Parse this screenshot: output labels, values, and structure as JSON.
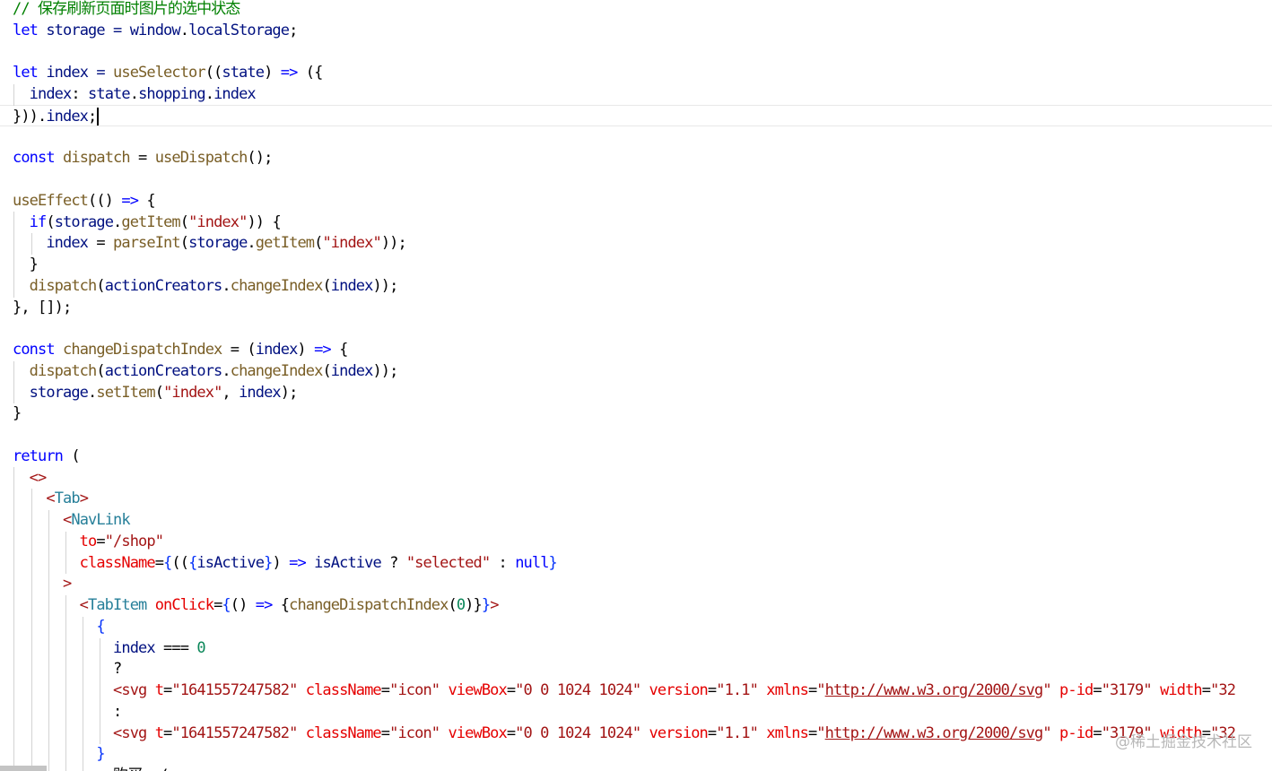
{
  "editor": {
    "lines": [
      {
        "tokens": [
          {
            "t": "// 保存刷新页面时图片的选中状态",
            "c": "comment"
          }
        ]
      },
      {
        "tokens": [
          {
            "t": "let",
            "c": "keyword"
          },
          {
            "t": " storage = ",
            "c": "var"
          },
          {
            "t": "window",
            "c": "var"
          },
          {
            "t": ".",
            "c": "punct"
          },
          {
            "t": "localStorage",
            "c": "var"
          },
          {
            "t": ";",
            "c": "punct"
          }
        ]
      },
      {
        "tokens": []
      },
      {
        "tokens": [
          {
            "t": "let",
            "c": "keyword"
          },
          {
            "t": " index = ",
            "c": "var"
          },
          {
            "t": "useSelector",
            "c": "func"
          },
          {
            "t": "((",
            "c": "punct"
          },
          {
            "t": "state",
            "c": "var"
          },
          {
            "t": ") ",
            "c": "punct"
          },
          {
            "t": "=>",
            "c": "keyword"
          },
          {
            "t": " ({",
            "c": "punct"
          }
        ]
      },
      {
        "tokens": [
          {
            "t": "  index",
            "c": "var"
          },
          {
            "t": ": ",
            "c": "punct"
          },
          {
            "t": "state",
            "c": "var"
          },
          {
            "t": ".",
            "c": "punct"
          },
          {
            "t": "shopping",
            "c": "var"
          },
          {
            "t": ".",
            "c": "punct"
          },
          {
            "t": "index",
            "c": "var"
          }
        ]
      },
      {
        "tokens": [
          {
            "t": "})).",
            "c": "punct"
          },
          {
            "t": "index",
            "c": "var"
          },
          {
            "t": ";",
            "c": "punct"
          }
        ],
        "current": true
      },
      {
        "tokens": []
      },
      {
        "tokens": [
          {
            "t": "const",
            "c": "keyword"
          },
          {
            "t": " dispatch",
            "c": "func"
          },
          {
            "t": " = ",
            "c": "punct"
          },
          {
            "t": "useDispatch",
            "c": "func"
          },
          {
            "t": "();",
            "c": "punct"
          }
        ]
      },
      {
        "tokens": []
      },
      {
        "tokens": [
          {
            "t": "useEffect",
            "c": "func"
          },
          {
            "t": "(() ",
            "c": "punct"
          },
          {
            "t": "=>",
            "c": "keyword"
          },
          {
            "t": " {",
            "c": "punct"
          }
        ]
      },
      {
        "tokens": [
          {
            "t": "  if",
            "c": "keyword"
          },
          {
            "t": "(",
            "c": "punct"
          },
          {
            "t": "storage",
            "c": "var"
          },
          {
            "t": ".",
            "c": "punct"
          },
          {
            "t": "getItem",
            "c": "func"
          },
          {
            "t": "(",
            "c": "punct"
          },
          {
            "t": "\"index\"",
            "c": "str"
          },
          {
            "t": ")) {",
            "c": "punct"
          }
        ]
      },
      {
        "tokens": [
          {
            "t": "    index",
            "c": "var"
          },
          {
            "t": " = ",
            "c": "punct"
          },
          {
            "t": "parseInt",
            "c": "func"
          },
          {
            "t": "(",
            "c": "punct"
          },
          {
            "t": "storage",
            "c": "var"
          },
          {
            "t": ".",
            "c": "punct"
          },
          {
            "t": "getItem",
            "c": "func"
          },
          {
            "t": "(",
            "c": "punct"
          },
          {
            "t": "\"index\"",
            "c": "str"
          },
          {
            "t": "));",
            "c": "punct"
          }
        ]
      },
      {
        "tokens": [
          {
            "t": "  }",
            "c": "punct"
          }
        ]
      },
      {
        "tokens": [
          {
            "t": "  dispatch",
            "c": "func"
          },
          {
            "t": "(",
            "c": "punct"
          },
          {
            "t": "actionCreators",
            "c": "var"
          },
          {
            "t": ".",
            "c": "punct"
          },
          {
            "t": "changeIndex",
            "c": "func"
          },
          {
            "t": "(",
            "c": "punct"
          },
          {
            "t": "index",
            "c": "var"
          },
          {
            "t": "));",
            "c": "punct"
          }
        ]
      },
      {
        "tokens": [
          {
            "t": "}, []);",
            "c": "punct"
          }
        ]
      },
      {
        "tokens": []
      },
      {
        "tokens": [
          {
            "t": "const",
            "c": "keyword"
          },
          {
            "t": " changeDispatchIndex",
            "c": "func"
          },
          {
            "t": " = (",
            "c": "punct"
          },
          {
            "t": "index",
            "c": "var"
          },
          {
            "t": ") ",
            "c": "punct"
          },
          {
            "t": "=>",
            "c": "keyword"
          },
          {
            "t": " {",
            "c": "punct"
          }
        ]
      },
      {
        "tokens": [
          {
            "t": "  dispatch",
            "c": "func"
          },
          {
            "t": "(",
            "c": "punct"
          },
          {
            "t": "actionCreators",
            "c": "var"
          },
          {
            "t": ".",
            "c": "punct"
          },
          {
            "t": "changeIndex",
            "c": "func"
          },
          {
            "t": "(",
            "c": "punct"
          },
          {
            "t": "index",
            "c": "var"
          },
          {
            "t": "));",
            "c": "punct"
          }
        ]
      },
      {
        "tokens": [
          {
            "t": "  storage",
            "c": "var"
          },
          {
            "t": ".",
            "c": "punct"
          },
          {
            "t": "setItem",
            "c": "func"
          },
          {
            "t": "(",
            "c": "punct"
          },
          {
            "t": "\"index\"",
            "c": "str"
          },
          {
            "t": ", ",
            "c": "punct"
          },
          {
            "t": "index",
            "c": "var"
          },
          {
            "t": ");",
            "c": "punct"
          }
        ]
      },
      {
        "tokens": [
          {
            "t": "}",
            "c": "punct"
          }
        ]
      },
      {
        "tokens": []
      },
      {
        "tokens": [
          {
            "t": "return",
            "c": "keyword"
          },
          {
            "t": " (",
            "c": "punct"
          }
        ]
      },
      {
        "tokens": [
          {
            "t": "  <>",
            "c": "str"
          }
        ]
      },
      {
        "tokens": [
          {
            "t": "    <",
            "c": "str"
          },
          {
            "t": "Tab",
            "c": "tag"
          },
          {
            "t": ">",
            "c": "str"
          }
        ]
      },
      {
        "tokens": [
          {
            "t": "      <",
            "c": "str"
          },
          {
            "t": "NavLink",
            "c": "tag"
          }
        ]
      },
      {
        "tokens": [
          {
            "t": "        to",
            "c": "attr"
          },
          {
            "t": "=",
            "c": "punct"
          },
          {
            "t": "\"/shop\"",
            "c": "str"
          }
        ]
      },
      {
        "tokens": [
          {
            "t": "        className",
            "c": "attr"
          },
          {
            "t": "=",
            "c": "punct"
          },
          {
            "t": "{",
            "c": "brace"
          },
          {
            "t": "((",
            "c": "punct"
          },
          {
            "t": "{",
            "c": "brace"
          },
          {
            "t": "isActive",
            "c": "var"
          },
          {
            "t": "}",
            "c": "brace"
          },
          {
            "t": ") ",
            "c": "punct"
          },
          {
            "t": "=>",
            "c": "keyword"
          },
          {
            "t": " isActive",
            "c": "var"
          },
          {
            "t": " ? ",
            "c": "punct"
          },
          {
            "t": "\"selected\"",
            "c": "str"
          },
          {
            "t": " : ",
            "c": "punct"
          },
          {
            "t": "null",
            "c": "keyword"
          },
          {
            "t": "}",
            "c": "brace"
          }
        ]
      },
      {
        "tokens": [
          {
            "t": "      >",
            "c": "str"
          }
        ]
      },
      {
        "tokens": [
          {
            "t": "        <",
            "c": "str"
          },
          {
            "t": "TabItem",
            "c": "tag"
          },
          {
            "t": " onClick",
            "c": "attr"
          },
          {
            "t": "=",
            "c": "punct"
          },
          {
            "t": "{",
            "c": "brace"
          },
          {
            "t": "() ",
            "c": "punct"
          },
          {
            "t": "=>",
            "c": "keyword"
          },
          {
            "t": " {",
            "c": "punct"
          },
          {
            "t": "changeDispatchIndex",
            "c": "func"
          },
          {
            "t": "(",
            "c": "punct"
          },
          {
            "t": "0",
            "c": "num"
          },
          {
            "t": ")}",
            "c": "punct"
          },
          {
            "t": "}",
            "c": "brace"
          },
          {
            "t": ">",
            "c": "str"
          }
        ]
      },
      {
        "tokens": [
          {
            "t": "          {",
            "c": "brace"
          }
        ]
      },
      {
        "tokens": [
          {
            "t": "            index",
            "c": "var"
          },
          {
            "t": " === ",
            "c": "punct"
          },
          {
            "t": "0",
            "c": "num"
          }
        ]
      },
      {
        "tokens": [
          {
            "t": "            ?",
            "c": "punct"
          }
        ]
      },
      {
        "tokens": [
          {
            "t": "            <",
            "c": "str"
          },
          {
            "t": "svg",
            "c": "str"
          },
          {
            "t": " t",
            "c": "attr"
          },
          {
            "t": "=",
            "c": "punct"
          },
          {
            "t": "\"1641557247582\"",
            "c": "str"
          },
          {
            "t": " className",
            "c": "attr"
          },
          {
            "t": "=",
            "c": "punct"
          },
          {
            "t": "\"icon\"",
            "c": "str"
          },
          {
            "t": " viewBox",
            "c": "attr"
          },
          {
            "t": "=",
            "c": "punct"
          },
          {
            "t": "\"0 0 1024 1024\"",
            "c": "str"
          },
          {
            "t": " version",
            "c": "attr"
          },
          {
            "t": "=",
            "c": "punct"
          },
          {
            "t": "\"1.1\"",
            "c": "str"
          },
          {
            "t": " xmlns",
            "c": "attr"
          },
          {
            "t": "=",
            "c": "punct"
          },
          {
            "t": "\"",
            "c": "str"
          },
          {
            "t": "http://www.w3.org/2000/svg",
            "c": "url"
          },
          {
            "t": "\"",
            "c": "str"
          },
          {
            "t": " p-id",
            "c": "attr"
          },
          {
            "t": "=",
            "c": "punct"
          },
          {
            "t": "\"3179\"",
            "c": "str"
          },
          {
            "t": " width",
            "c": "attr"
          },
          {
            "t": "=",
            "c": "punct"
          },
          {
            "t": "\"32",
            "c": "str"
          }
        ]
      },
      {
        "tokens": [
          {
            "t": "            :",
            "c": "punct"
          }
        ]
      },
      {
        "tokens": [
          {
            "t": "            <",
            "c": "str"
          },
          {
            "t": "svg",
            "c": "str"
          },
          {
            "t": " t",
            "c": "attr"
          },
          {
            "t": "=",
            "c": "punct"
          },
          {
            "t": "\"1641557247582\"",
            "c": "str"
          },
          {
            "t": " className",
            "c": "attr"
          },
          {
            "t": "=",
            "c": "punct"
          },
          {
            "t": "\"icon\"",
            "c": "str"
          },
          {
            "t": " viewBox",
            "c": "attr"
          },
          {
            "t": "=",
            "c": "punct"
          },
          {
            "t": "\"0 0 1024 1024\"",
            "c": "str"
          },
          {
            "t": " version",
            "c": "attr"
          },
          {
            "t": "=",
            "c": "punct"
          },
          {
            "t": "\"1.1\"",
            "c": "str"
          },
          {
            "t": " xmlns",
            "c": "attr"
          },
          {
            "t": "=",
            "c": "punct"
          },
          {
            "t": "\"",
            "c": "str"
          },
          {
            "t": "http://www.w3.org/2000/svg",
            "c": "url"
          },
          {
            "t": "\"",
            "c": "str"
          },
          {
            "t": " p-id",
            "c": "attr"
          },
          {
            "t": "=",
            "c": "punct"
          },
          {
            "t": "\"3179\"",
            "c": "str"
          },
          {
            "t": " width",
            "c": "attr"
          },
          {
            "t": "=",
            "c": "punct"
          },
          {
            "t": "\"32",
            "c": "str"
          }
        ]
      },
      {
        "tokens": [
          {
            "t": "          }",
            "c": "brace"
          }
        ]
      },
      {
        "tokens": [
          {
            "t": "            购买 </",
            "c": "punct"
          }
        ]
      }
    ]
  },
  "watermark": "@稀土掘金技术社区"
}
